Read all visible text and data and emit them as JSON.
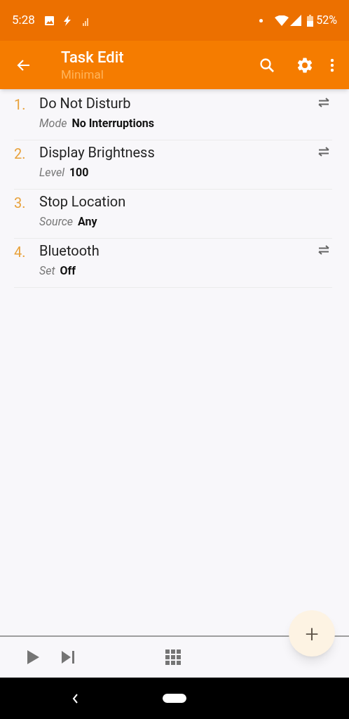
{
  "status_bar": {
    "time": "5:28",
    "battery": "52%"
  },
  "app_bar": {
    "title": "Task Edit",
    "subtitle": "Minimal"
  },
  "actions": [
    {
      "number": "1.",
      "name": "Do Not Disturb",
      "param_label": "Mode",
      "param_value": "No Interruptions",
      "swap_icon": true
    },
    {
      "number": "2.",
      "name": "Display Brightness",
      "param_label": "Level",
      "param_value": "100",
      "swap_icon": true
    },
    {
      "number": "3.",
      "name": "Stop Location",
      "param_label": "Source",
      "param_value": "Any",
      "swap_icon": false
    },
    {
      "number": "4.",
      "name": "Bluetooth",
      "param_label": "Set",
      "param_value": "Off",
      "swap_icon": true
    }
  ],
  "fab": {
    "label": "+"
  }
}
